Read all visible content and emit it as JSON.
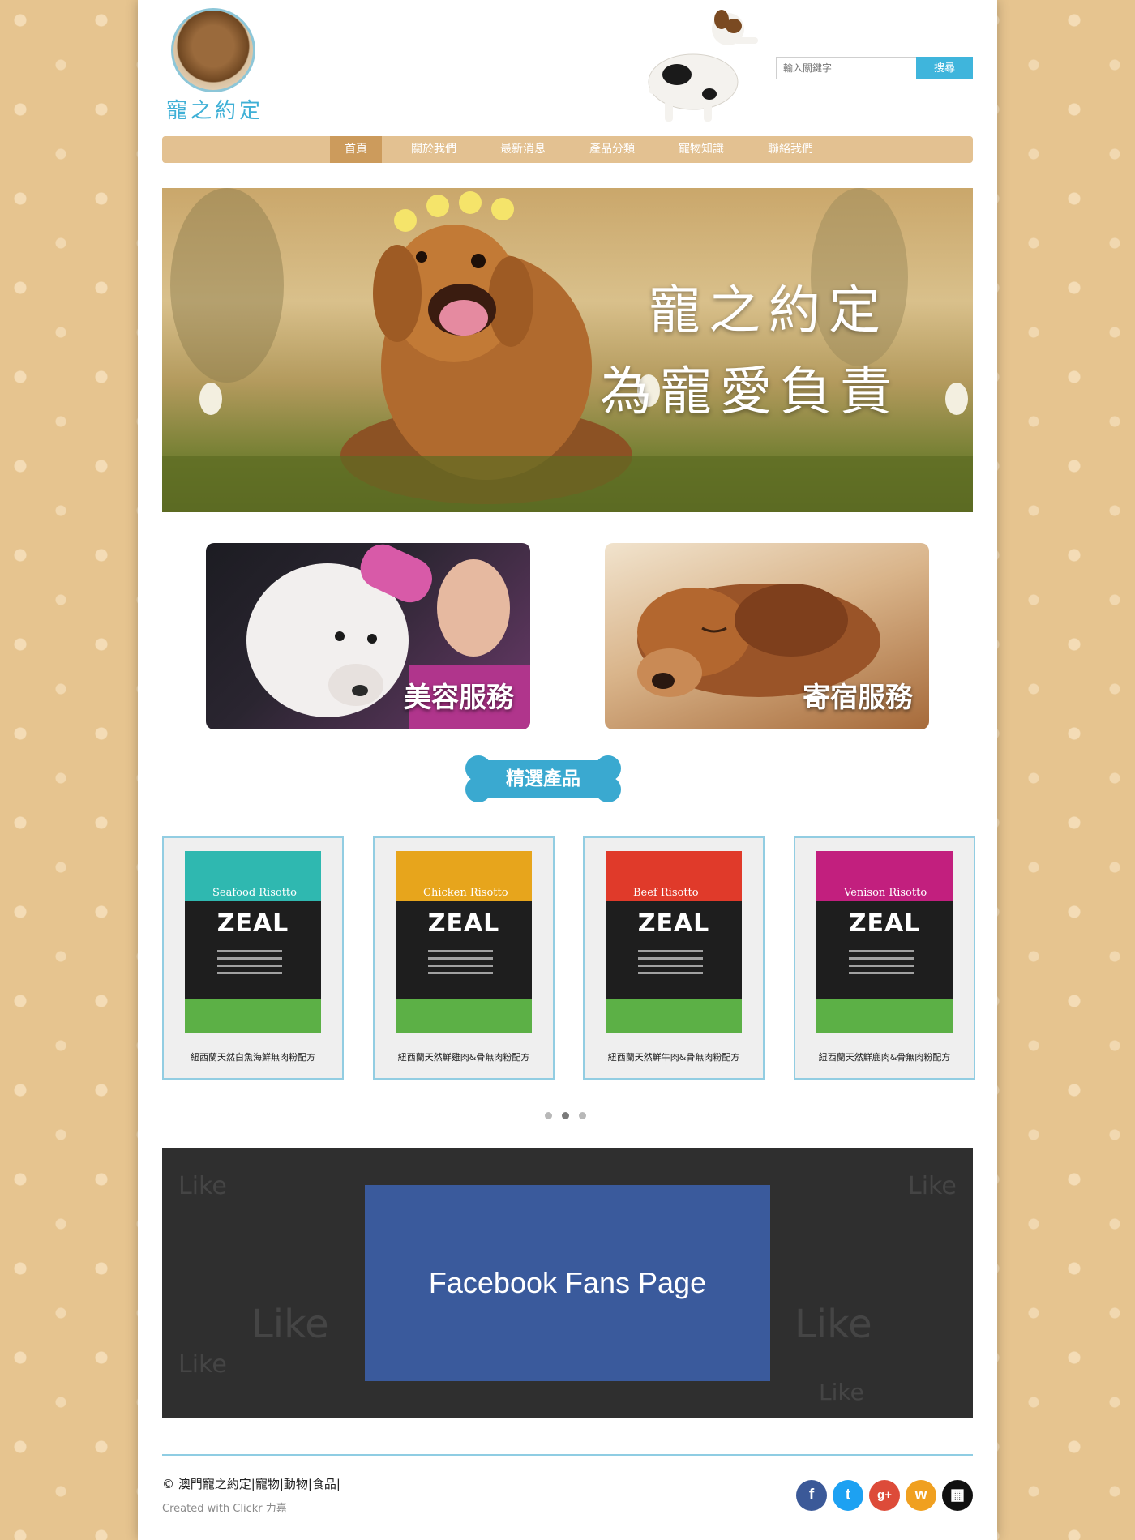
{
  "header": {
    "logo_text": "寵之約定",
    "search": {
      "placeholder": "輸入關鍵字",
      "button_label": "搜尋"
    }
  },
  "nav": {
    "items": [
      {
        "label": "首頁",
        "active": true
      },
      {
        "label": "關於我們",
        "active": false
      },
      {
        "label": "最新消息",
        "active": false
      },
      {
        "label": "產品分類",
        "active": false
      },
      {
        "label": "寵物知識",
        "active": false
      },
      {
        "label": "聯絡我們",
        "active": false
      }
    ]
  },
  "hero": {
    "line1": "寵之約定",
    "line2": "為寵愛負責"
  },
  "services": [
    {
      "label": "美容服務"
    },
    {
      "label": "寄宿服務"
    }
  ],
  "featured": {
    "title": "精選產品",
    "products": [
      {
        "name": "紐西蘭天然白魚海鮮無肉粉配方",
        "flavor": "Seafood Risotto",
        "brand": "ZEAL",
        "color": "#2fb8b0"
      },
      {
        "name": "紐西蘭天然鮮雞肉&骨無肉粉配方",
        "flavor": "Chicken Risotto",
        "brand": "ZEAL",
        "color": "#e7a51c"
      },
      {
        "name": "紐西蘭天然鮮牛肉&骨無肉粉配方",
        "flavor": "Beef Risotto",
        "brand": "ZEAL",
        "color": "#e03a2a"
      },
      {
        "name": "紐西蘭天然鮮鹿肉&骨無肉粉配方",
        "flavor": "Venison Risotto",
        "brand": "ZEAL",
        "color": "#c21f7e"
      }
    ],
    "carousel_pages": 3,
    "carousel_active": 2
  },
  "facebook": {
    "label": "Facebook Fans Page",
    "bg_word": "Like"
  },
  "footer": {
    "copyright": "© 澳門寵之約定|寵物|動物|食品|",
    "credit": "Created with Clickr 力嘉",
    "socials": [
      {
        "icon": "facebook-icon",
        "glyph": "f",
        "color": "#3b5998"
      },
      {
        "icon": "twitter-icon",
        "glyph": "t",
        "color": "#1da1f2"
      },
      {
        "icon": "google-plus-icon",
        "glyph": "g+",
        "color": "#dd4b39"
      },
      {
        "icon": "weibo-icon",
        "glyph": "w",
        "color": "#f0a020"
      },
      {
        "icon": "qr-code-icon",
        "glyph": "▦",
        "color": "#111111"
      }
    ]
  }
}
